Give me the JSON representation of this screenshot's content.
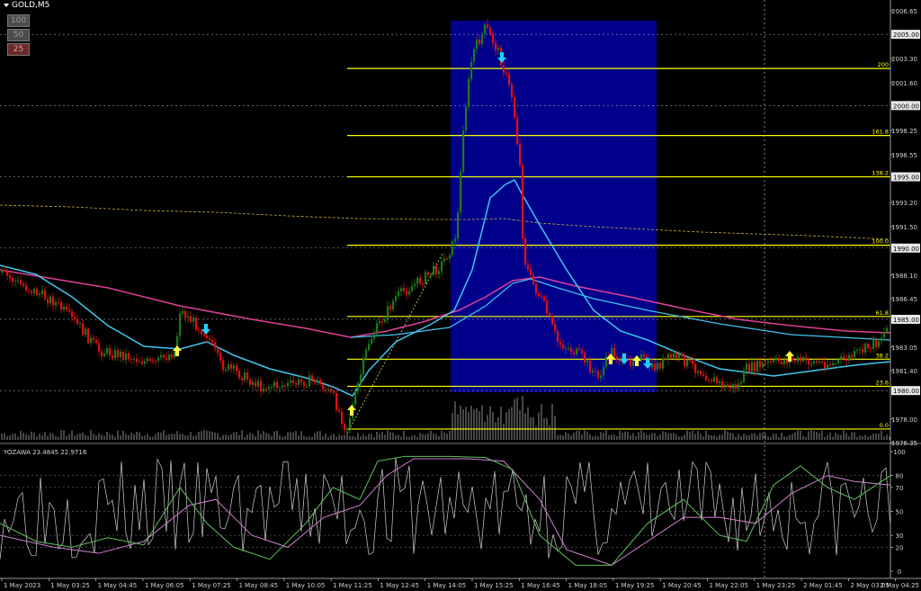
{
  "window": {
    "symbol": "GOLD,M5"
  },
  "zoom_buttons": [
    {
      "label": "100",
      "active": false
    },
    {
      "label": "50",
      "active": false
    },
    {
      "label": "25",
      "active": true
    }
  ],
  "indicator": {
    "name": "YOZAWA",
    "value1": "23.4845",
    "value2": "22.9716",
    "label": "YOZAWA 23.4845 22.9716"
  },
  "price_axis": {
    "ticks": [
      "2006.65",
      "2003.30",
      "2001.60",
      "1998.25",
      "1996.55",
      "1993.20",
      "1991.50",
      "1988.10",
      "1986.45",
      "1983.05",
      "1981.40",
      "1978.00",
      "1976.35"
    ],
    "marked": [
      "2005.00",
      "2000.00",
      "1995.00",
      "1990.00",
      "1985.00",
      "1980.00"
    ]
  },
  "fib_levels": [
    "200",
    "161.8",
    "138.2",
    "100.0",
    "61.8",
    "38.2",
    "23.6",
    "0.0"
  ],
  "osc_axis": [
    "100",
    "80",
    "70",
    "50",
    "30",
    "20",
    "0"
  ],
  "time_axis": [
    "1 May 2023",
    "1 May 03:25",
    "1 May 04:45",
    "1 May 06:05",
    "1 May 07:25",
    "1 May 08:45",
    "1 May 10:05",
    "1 May 11:25",
    "1 May 12:45",
    "1 May 14:05",
    "1 May 15:25",
    "1 May 16:45",
    "1 May 18:05",
    "1 May 19:25",
    "1 May 20:45",
    "1 May 22:05",
    "1 May 23:25",
    "2 May 01:45",
    "2 May 03:05",
    "2 May 04:25"
  ],
  "colors": {
    "bull": "#1e7a1e",
    "bear": "#e01010",
    "fib": "#ffff00",
    "box": "#00008b",
    "ma_fast": "#3ec7ee",
    "ma_slow": "#e0409a",
    "arrow_up": "#ffff40",
    "arrow_down": "#20d0ff",
    "grid": "#c8c8c8"
  },
  "icons": {
    "arrow_up": "up-arrow-icon",
    "arrow_down": "down-arrow-icon"
  },
  "chart_data": {
    "type": "candlestick",
    "symbol": "GOLD",
    "timeframe": "M5",
    "ylim": [
      1976.35,
      2006.65
    ],
    "fib_prices": {
      "200": 2002.6,
      "161.8": 1997.9,
      "138.2": 1995.0,
      "100.0": 1990.2,
      "61.8": 1985.2,
      "38.2": 1982.2,
      "23.6": 1980.3,
      "0.0": 1977.3
    },
    "key_prices": [
      [
        "1 May 2023",
        1989.0
      ],
      [
        "1 May 03:25",
        1986.5
      ],
      [
        "1 May 04:45",
        1983.5
      ],
      [
        "1 May 06:05",
        1982.5
      ],
      [
        "1 May 07:25",
        1985.0
      ],
      [
        "1 May 08:45",
        1981.0
      ],
      [
        "1 May 10:05",
        1981.0
      ],
      [
        "1 May 11:25",
        1977.3
      ],
      [
        "1 May 12:45",
        1987.5
      ],
      [
        "1 May 14:05",
        1989.5
      ],
      [
        "1 May 15:25",
        2005.5
      ],
      [
        "1 May 16:45",
        1989.5
      ],
      [
        "1 May 18:05",
        1981.5
      ],
      [
        "1 May 19:25",
        1982.0
      ],
      [
        "1 May 20:45",
        1981.0
      ],
      [
        "1 May 22:05",
        1980.0
      ],
      [
        "1 May 23:25",
        1982.0
      ],
      [
        "2 May 01:45",
        1982.5
      ],
      [
        "2 May 03:05",
        1983.5
      ],
      [
        "2 May 04:25",
        1985.0
      ]
    ]
  }
}
